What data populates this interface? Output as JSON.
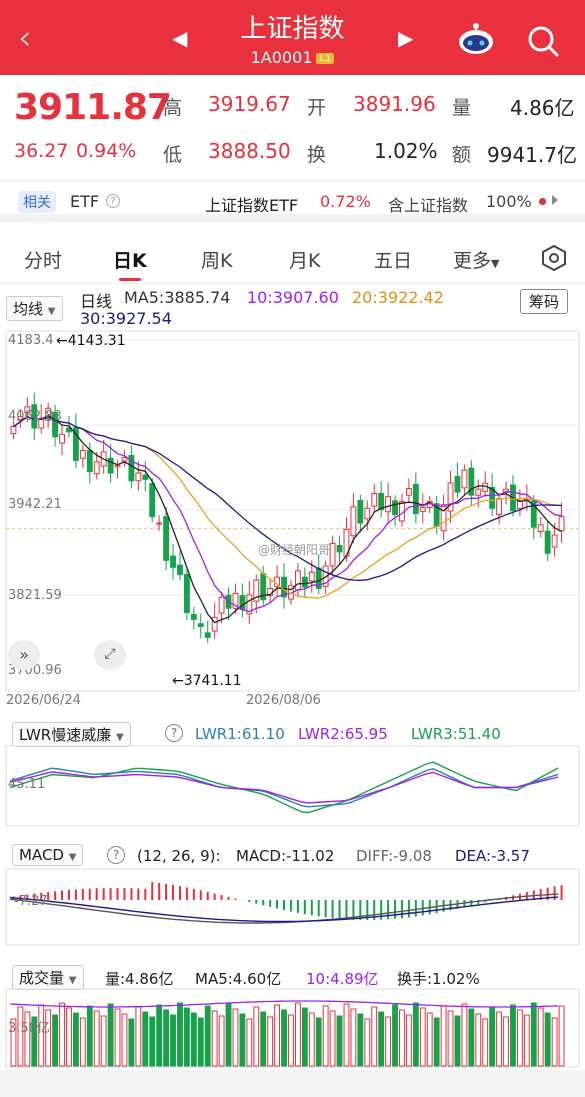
{
  "header": {
    "back_icon": "back-chevron-icon",
    "prev_icon": "prev-triangle-icon",
    "next_icon": "next-triangle-icon",
    "title": "上证指数",
    "code": "1A0001",
    "badge": "L1",
    "robot_icon": "robot-icon",
    "search_icon": "search-icon"
  },
  "quote": {
    "price": "3911.87",
    "change": "36.27",
    "pct": "0.94%",
    "high_label": "高",
    "high": "3919.67",
    "open_label": "开",
    "open": "3891.96",
    "vol_label": "量",
    "vol": "4.86亿",
    "low_label": "低",
    "low": "3888.50",
    "turn_label": "换",
    "turn": "1.02%",
    "amt_label": "额",
    "amt": "9941.7亿"
  },
  "related": {
    "tag": "相关",
    "etf": "ETF",
    "info_icon": "info-icon",
    "etf_name": "上证指数ETF",
    "etf_pct": "0.72%",
    "hold_text": "含上证指数",
    "hold_pct": "100%"
  },
  "tabs": [
    "分时",
    "日K",
    "周K",
    "月K",
    "五日",
    "更多"
  ],
  "settings_icon": "settings-hexagon-icon",
  "kchart": {
    "indicator": "均线",
    "line_type": "日线",
    "ma5": "MA5:3885.74",
    "ma10": "10:3907.60",
    "ma20": "20:3922.42",
    "ma30": "30:3927.54",
    "chips_btn": "筹码",
    "y_labels": [
      "4183.4",
      "4062.83",
      "3942.21",
      "3821.59",
      "3700.96"
    ],
    "high_mark": "←4143.31",
    "low_mark": "←3741.11",
    "dates": [
      "2026/06/24",
      "2026/08/06"
    ],
    "expand_icon": "expand-arrows-icon",
    "fullscreen_icon": "fullscreen-icon",
    "watermark": "@财经朝阳哥"
  },
  "lwr": {
    "name": "LWR慢速威廉",
    "help_icon": "help-icon",
    "l1": "LWR1:61.10",
    "l2": "LWR2:65.95",
    "l3": "LWR3:51.40",
    "ylab": "45.11"
  },
  "macd": {
    "name": "MACD",
    "params": "(12, 26, 9):",
    "macd": "MACD:-11.02",
    "diff": "DIFF:-9.08",
    "dea": "DEA:-3.57",
    "ylab": "-7.27"
  },
  "vol": {
    "name": "成交量",
    "vol": "量:4.86亿",
    "ma5": "MA5:4.60亿",
    "ma10": "10:4.89亿",
    "turn": "换手:1.02%",
    "ylab": "3.58亿"
  },
  "colors": {
    "up": "#e8313c",
    "down": "#15a34a",
    "ma5": "#222222",
    "ma10": "#a020f0",
    "ma20": "#f0a020",
    "ma30": "#1a1a8a"
  }
}
